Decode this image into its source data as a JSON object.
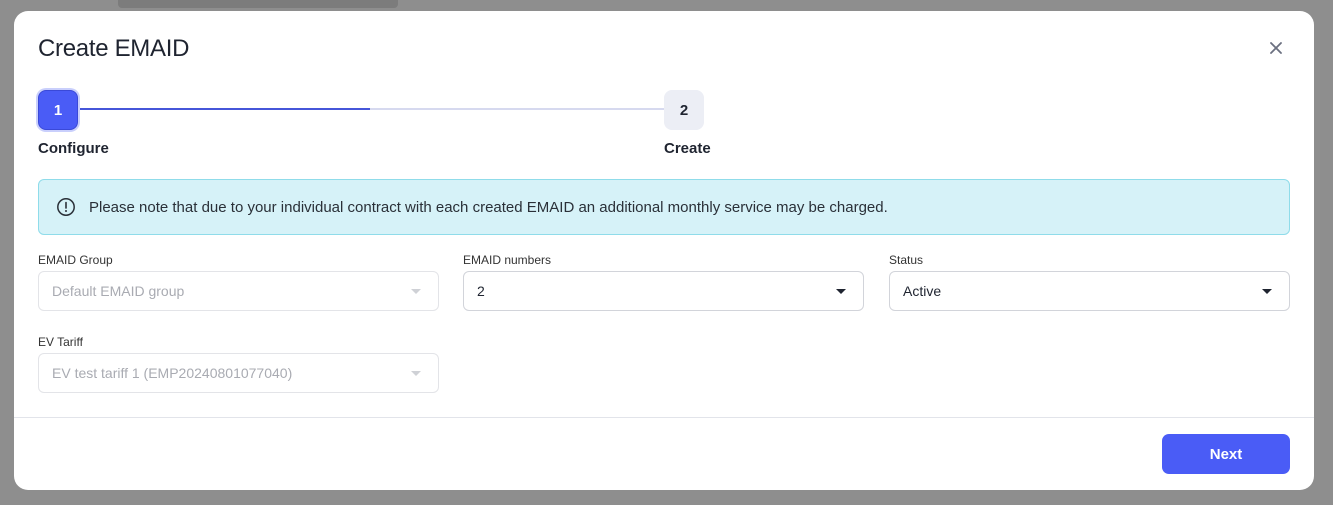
{
  "modal": {
    "title": "Create EMAID",
    "close_icon": "close-icon"
  },
  "stepper": {
    "steps": [
      {
        "number": "1",
        "label": "Configure",
        "active": true
      },
      {
        "number": "2",
        "label": "Create",
        "active": false
      }
    ],
    "progress": 0.5
  },
  "alert": {
    "icon": "info-circle-icon",
    "text": "Please note that due to your individual contract with each created EMAID an additional monthly service may be charged."
  },
  "form": {
    "emaid_group": {
      "label": "EMAID Group",
      "value": "Default EMAID group",
      "disabled": true
    },
    "emaid_numbers": {
      "label": "EMAID numbers",
      "value": "2",
      "disabled": false
    },
    "status": {
      "label": "Status",
      "value": "Active",
      "disabled": false
    },
    "ev_tariff": {
      "label": "EV Tariff",
      "value": "EV test tariff 1 (EMP20240801077040)",
      "disabled": true
    }
  },
  "footer": {
    "next_label": "Next"
  },
  "colors": {
    "accent": "#4a5cf6",
    "alert_bg": "#d6f2f8",
    "alert_border": "#8fdcea"
  }
}
